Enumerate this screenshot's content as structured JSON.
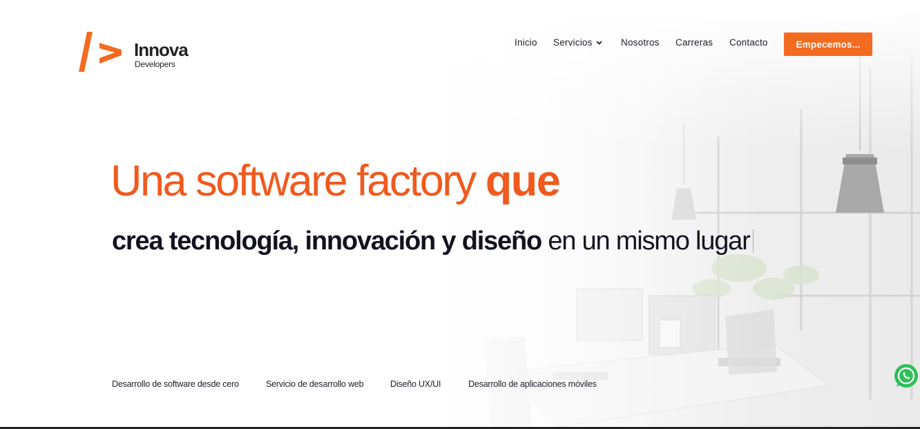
{
  "brand": {
    "name": "Innova",
    "tagline": "Developers",
    "accent": "#f36b21",
    "headline_color": "#f05a1e"
  },
  "nav": {
    "items": [
      {
        "label": "Inicio"
      },
      {
        "label": "Servicios",
        "dropdown": true
      },
      {
        "label": "Nosotros"
      },
      {
        "label": "Carreras"
      },
      {
        "label": "Contacto"
      }
    ],
    "cta_label": "Empecemos..."
  },
  "hero": {
    "headline_regular": "Una software factory ",
    "headline_bold": "que",
    "sub_bold": "crea tecnología, innovación y diseño",
    "sub_regular": " en un mismo lugar"
  },
  "services": [
    "Desarrollo de software desde cero",
    "Servicio de desarrollo web",
    "Diseño UX/UI",
    "Desarrollo de aplicaciones móviles"
  ],
  "icons": {
    "chevron": "chevron-down-icon",
    "whatsapp": "whatsapp-icon",
    "logo": "innova-logo-mark"
  }
}
